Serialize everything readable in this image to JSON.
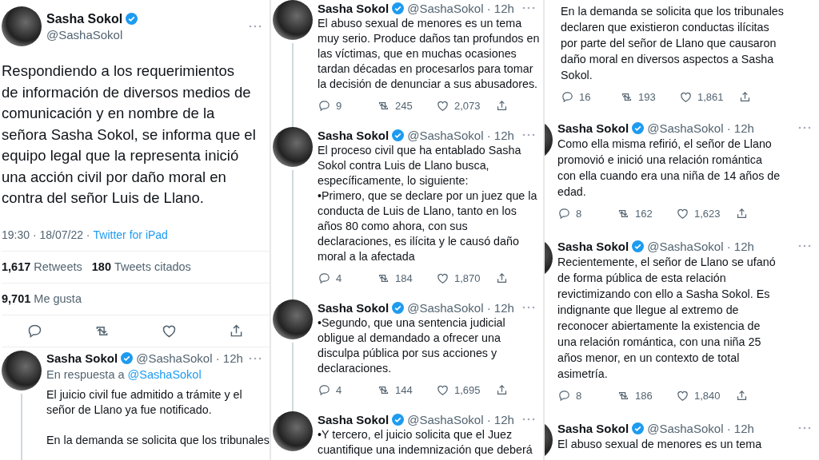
{
  "panels": [
    {
      "items": [
        {
          "kind": "main_tweet",
          "name": "Sasha Sokol",
          "verified": true,
          "handle": "@SashaSokol",
          "text": "Respondiendo a los requerimientos\nde información de diversos medios de\ncomunicación y en nombre de la\nseñora Sasha Sokol, se informa que el\nequipo legal que la representa inició\nuna acción civil por daño moral en\ncontra del señor Luis de Llano.",
          "timestamp": "19:30 · 18/07/22 ·",
          "source": "Twitter for iPad",
          "engagement": [
            {
              "count": "1,617",
              "label": "Retweets"
            },
            {
              "count": "180",
              "label": "Tweets citados"
            }
          ],
          "likes": {
            "count": "9,701",
            "label": "Me gusta"
          }
        },
        {
          "kind": "tweet",
          "name": "Sasha Sokol",
          "verified": true,
          "handle_line": "@SashaSokol · 12h",
          "thread": true,
          "reply_to_label": "En respuesta a",
          "reply_to": "@SashaSokol",
          "text": "El juicio civil fue admitido a trámite y el\nseñor de Llano ya fue notificado.\n\nEn la demanda se solicita que los tribunales"
        }
      ]
    },
    {
      "items": [
        {
          "kind": "tweet",
          "name": "Sasha Sokol",
          "verified": true,
          "handle_line": "@SashaSokol · 12h",
          "thread": true,
          "text": "El abuso sexual de menores es un tema\nmuy serio. Produce daños tan profundos en\nlas víctimas, que en muchas ocasiones\ntardan décadas en procesarlos para tomar\nla decisión de denunciar a sus abusadores.",
          "stats": {
            "replies": "9",
            "retweets": "245",
            "likes": "2,073"
          }
        },
        {
          "kind": "tweet",
          "name": "Sasha Sokol",
          "verified": true,
          "handle_line": "@SashaSokol · 12h",
          "thread": true,
          "text": "El proceso civil que ha entablado Sasha\nSokol contra Luis de Llano busca,\nespecíficamente, lo siguiente:\n•Primero, que se declare por un juez que la\nconducta de Luis de Llano, tanto en los\naños 80 como ahora, con sus\ndeclaraciones, es ilícita y le causó daño\nmoral a la afectada",
          "stats": {
            "replies": "4",
            "retweets": "184",
            "likes": "1,870"
          }
        },
        {
          "kind": "tweet",
          "name": "Sasha Sokol",
          "verified": true,
          "handle_line": "@SashaSokol · 12h",
          "thread": true,
          "text": "•Segundo, que una sentencia judicial\nobligue al demandado a ofrecer una\ndisculpa pública por sus acciones y\ndeclaraciones.",
          "stats": {
            "replies": "4",
            "retweets": "144",
            "likes": "1,695"
          }
        },
        {
          "kind": "tweet",
          "name": "Sasha Sokol",
          "verified": true,
          "handle_line": "@SashaSokol · 12h",
          "thread": false,
          "text": "•Y tercero, el juicio solicita que el Juez\ncuantifique una indemnización que deberá"
        }
      ]
    },
    {
      "items": [
        {
          "kind": "continuation",
          "text": "En la demanda se solicita que los tribunales\ndeclaren que existieron conductas ilícitas\npor parte del señor de Llano que causaron\ndaño moral en diversos aspectos a Sasha\nSokol.",
          "stats": {
            "replies": "16",
            "retweets": "193",
            "likes": "1,861"
          }
        },
        {
          "kind": "tweet",
          "name": "Sasha Sokol",
          "verified": true,
          "handle_line": "@SashaSokol · 12h",
          "thread": false,
          "text": "Como ella misma refirió, el señor de Llano\npromovió e inició una relación romántica\ncon ella cuando era una niña de 14 años de\nedad.",
          "stats": {
            "replies": "8",
            "retweets": "162",
            "likes": "1,623"
          }
        },
        {
          "kind": "tweet",
          "name": "Sasha Sokol",
          "verified": true,
          "handle_line": "@SashaSokol · 12h",
          "thread": false,
          "text": "Recientemente, el señor de Llano se ufanó\nde forma pública de esta relación\nrevictimizando con ello a Sasha Sokol. Es\nindignante que llegue al extremo de\nreconocer abiertamente la existencia de\nuna relación romántica, con una niña 25\naños menor, en un contexto de total\nasimetría.",
          "stats": {
            "replies": "8",
            "retweets": "186",
            "likes": "1,840"
          }
        },
        {
          "kind": "tweet",
          "name": "Sasha Sokol",
          "verified": true,
          "handle_line": "@SashaSokol · 12h",
          "thread": false,
          "text": "El abuso sexual de menores es un tema"
        }
      ]
    }
  ]
}
